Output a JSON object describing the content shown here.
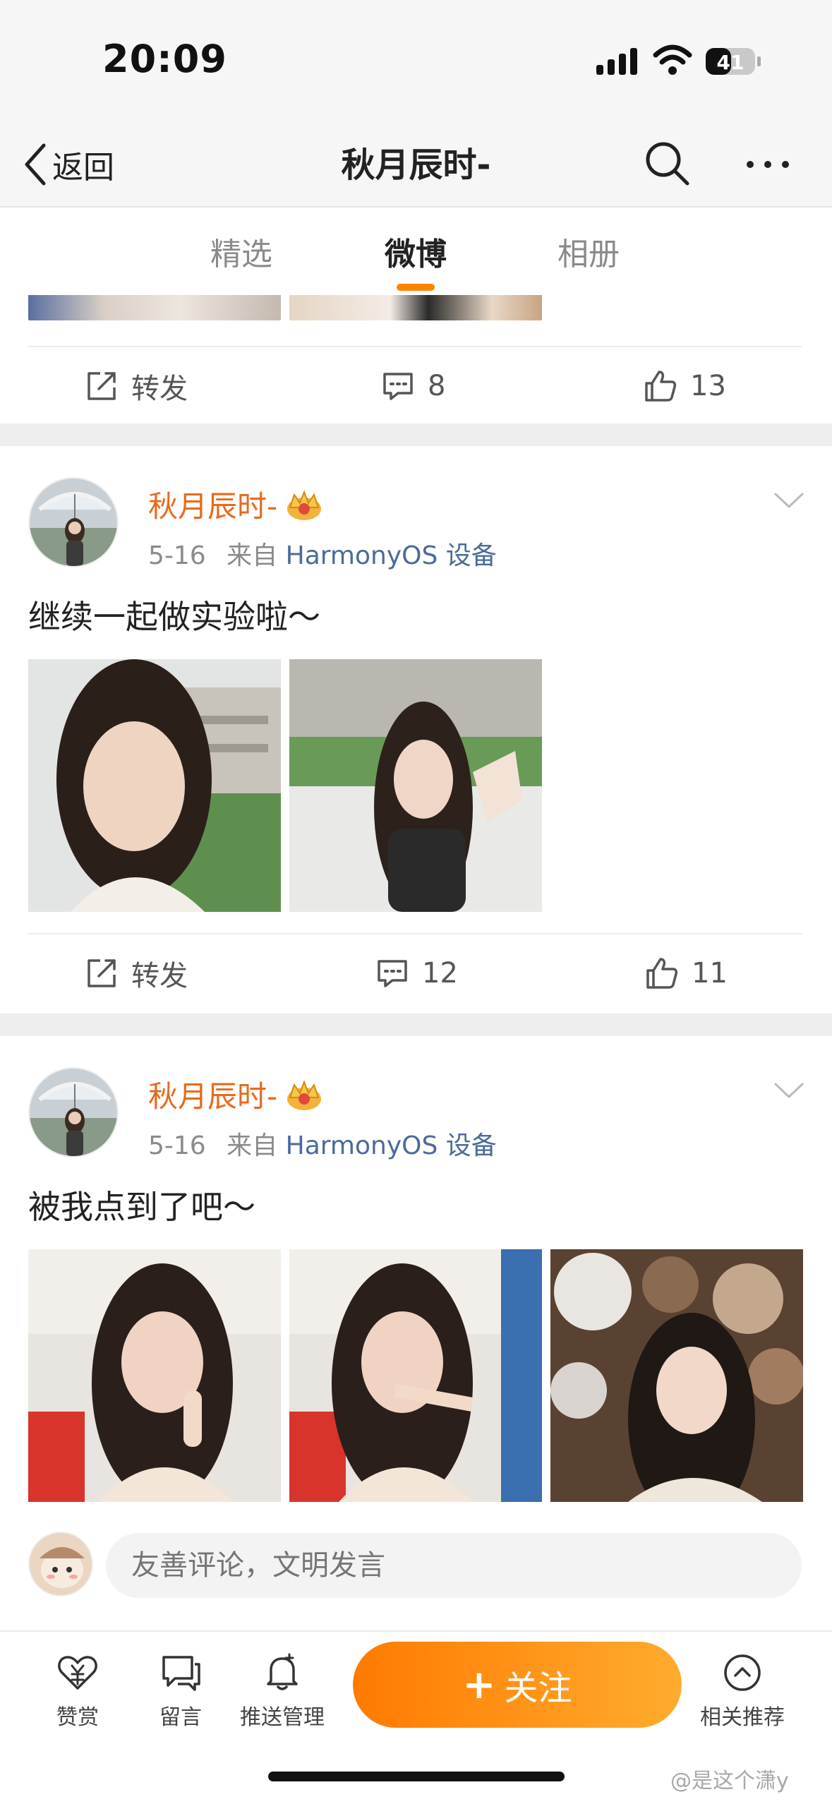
{
  "status": {
    "time": "20:09",
    "battery": "41"
  },
  "nav": {
    "back_label": "返回",
    "title": "秋月辰时-"
  },
  "tabs": [
    {
      "label": "精选"
    },
    {
      "label": "微博"
    },
    {
      "label": "相册"
    }
  ],
  "posts": [
    {
      "actions": {
        "repost": "转发",
        "comments": "8",
        "likes": "13"
      }
    },
    {
      "author": "秋月辰时-",
      "date": "5-16",
      "from": "来自",
      "device": "HarmonyOS 设备",
      "text": "继续一起做实验啦～",
      "actions": {
        "repost": "转发",
        "comments": "12",
        "likes": "11"
      }
    },
    {
      "author": "秋月辰时-",
      "date": "5-16",
      "from": "来自",
      "device": "HarmonyOS 设备",
      "text": "被我点到了吧～"
    }
  ],
  "comment": {
    "placeholder": "友善评论，文明发言"
  },
  "bottombar": {
    "reward": "赞赏",
    "message": "留言",
    "push": "推送管理",
    "follow": "关注",
    "follow_plus": "+",
    "recommend": "相关推荐"
  },
  "watermark": "@是这个潇y",
  "colors": {
    "accent": "#ff8200",
    "author": "#e86a1c",
    "device_link": "#4a6b9a"
  }
}
